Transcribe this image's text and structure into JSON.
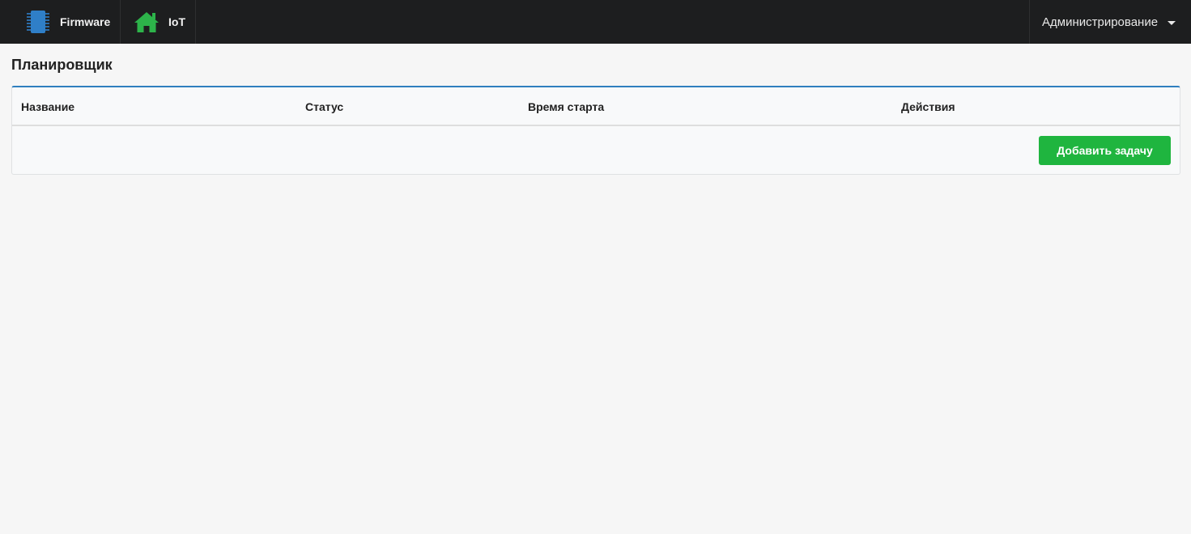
{
  "navbar": {
    "items": [
      {
        "label": "Firmware",
        "icon": "chip-icon",
        "icon_color": "#2f7fc8"
      },
      {
        "label": "IoT",
        "icon": "home-icon",
        "icon_color": "#2db34a"
      }
    ],
    "admin_menu": {
      "label": "Администрирование",
      "icon": "caret-down-icon"
    }
  },
  "page": {
    "title": "Планировщик"
  },
  "table": {
    "columns": [
      "Название",
      "Статус",
      "Время старта",
      "Действия"
    ],
    "rows": []
  },
  "actions": {
    "add_task_label": "Добавить задачу"
  },
  "colors": {
    "navbar_bg": "#1d1e1f",
    "accent": "#2f7fbf",
    "success": "#1fb53f"
  }
}
